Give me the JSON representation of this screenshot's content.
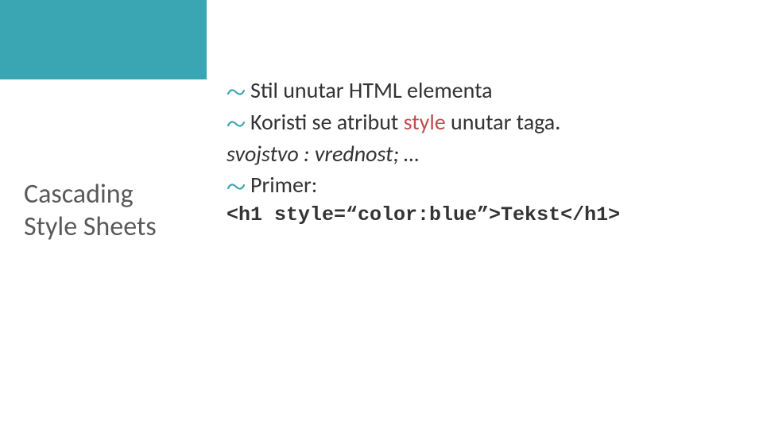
{
  "sidebar": {
    "title_line1": "Cascading",
    "title_line2": "Style  Sheets"
  },
  "main": {
    "bullet1": "Stil unutar HTML elementa",
    "bullet2a": "Koristi se atribut ",
    "bullet2_style": "style",
    "bullet2b": " unutar taga.",
    "line3": "svojstvo : vrednost; …",
    "bullet3": "Primer:",
    "code": "<h1 style=“color:blue”>Tekst</h1>"
  },
  "colors": {
    "accent": "#3ba6b3",
    "highlight": "#c0504d"
  }
}
